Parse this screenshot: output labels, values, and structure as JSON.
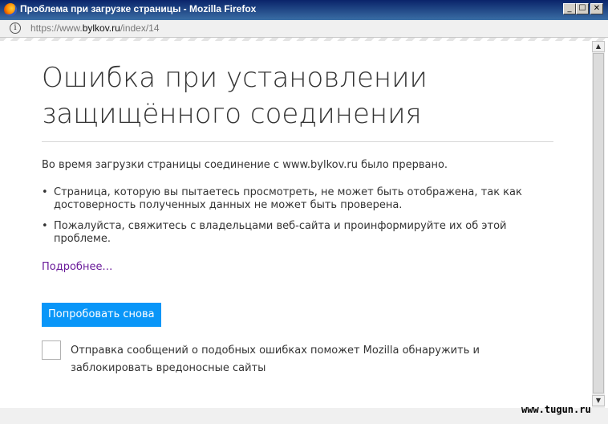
{
  "window": {
    "title": "Проблема при загрузке страницы - Mozilla Firefox",
    "min_symbol": "_",
    "max_symbol": "☐",
    "close_symbol": "✕"
  },
  "urlbar": {
    "info_symbol": "i",
    "url_prefix": "https://www.",
    "url_domain": "bylkov.ru",
    "url_path": "/index/14"
  },
  "page": {
    "title": "Ошибка при установлении защищённого соединения",
    "description": "Во время загрузки страницы соединение с www.bylkov.ru было прервано.",
    "bullets": [
      "Страница, которую вы пытаетесь просмотреть, не может быть отображена, так как достоверность полученных данных не может быть проверена.",
      "Пожалуйста, свяжитесь с владельцами веб-сайта и проинформируйте их об этой проблеме."
    ],
    "more_link": "Подробнее…",
    "retry_button": "Попробовать снова",
    "report_text": "Отправка сообщений о подобных ошибках поможет Mozilla обнаружить и заблокировать вредоносные сайты",
    "report_checked": false,
    "accent_color": "#0996f8"
  },
  "scrollbar": {
    "up_symbol": "▲",
    "down_symbol": "▼"
  },
  "watermark": "www.tugun.ru"
}
